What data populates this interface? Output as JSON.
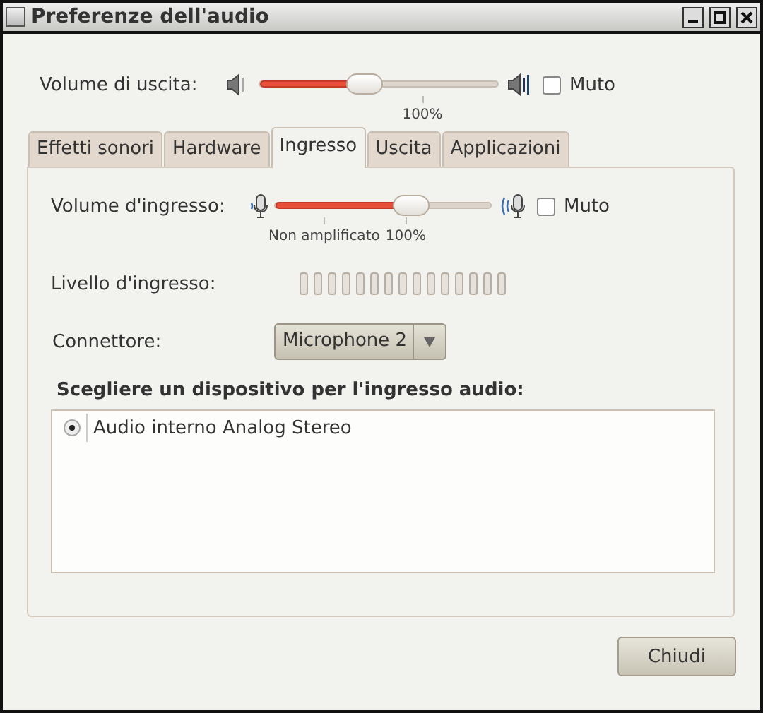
{
  "window": {
    "title": "Preferenze dell'audio"
  },
  "output": {
    "label": "Volume di uscita:",
    "level": 0.44,
    "tick_label": "100%",
    "mute_label": "Muto",
    "muted": false
  },
  "tabs": [
    {
      "label": "Effetti sonori",
      "selected": false
    },
    {
      "label": "Hardware",
      "selected": false
    },
    {
      "label": "Ingresso",
      "selected": true
    },
    {
      "label": "Uscita",
      "selected": false
    },
    {
      "label": "Applicazioni",
      "selected": false
    }
  ],
  "input": {
    "label": "Volume d'ingresso:",
    "level": 0.63,
    "tick_labels": [
      "Non amplificato",
      "100%"
    ],
    "mute_label": "Muto",
    "muted": false
  },
  "input_level": {
    "label": "Livello d'ingresso:"
  },
  "connector": {
    "label": "Connettore:",
    "value": "Microphone 2"
  },
  "devices": {
    "heading": "Scegliere un dispositivo per l'ingresso audio:",
    "items": [
      {
        "name": "Audio interno Analog Stereo",
        "selected": true
      }
    ]
  },
  "buttons": [
    "Chiudi"
  ]
}
